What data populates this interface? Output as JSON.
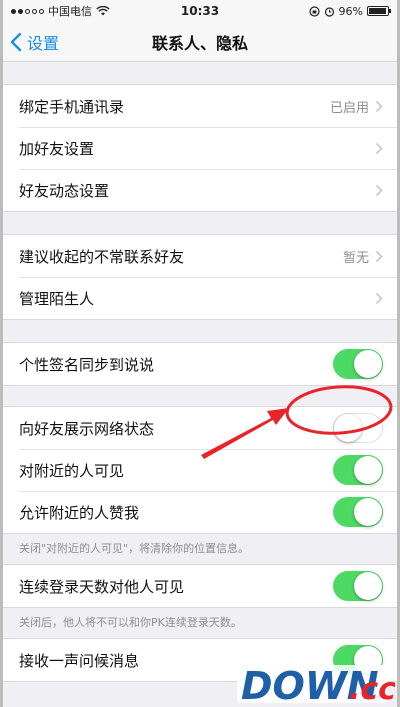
{
  "status_bar": {
    "carrier": "中国电信",
    "time": "10:33",
    "battery": "96%"
  },
  "nav": {
    "back_label": "设置",
    "title": "联系人、隐私"
  },
  "groups": [
    {
      "rows": [
        {
          "label": "绑定手机通讯录",
          "value": "已启用"
        },
        {
          "label": "加好友设置"
        },
        {
          "label": "好友动态设置"
        }
      ]
    },
    {
      "rows": [
        {
          "label": "建议收起的不常联系好友",
          "value": "暂无"
        },
        {
          "label": "管理陌生人"
        }
      ]
    },
    {
      "rows": [
        {
          "label": "个性签名同步到说说",
          "toggle": "on"
        }
      ]
    },
    {
      "rows": [
        {
          "label": "向好友展示网络状态",
          "toggle": "off"
        },
        {
          "label": "对附近的人可见",
          "toggle": "on"
        },
        {
          "label": "允许附近的人赞我",
          "toggle": "on"
        }
      ],
      "note": "关闭\"对附近的人可见\"，将清除你的位置信息。"
    },
    {
      "rows": [
        {
          "label": "连续登录天数对他人可见",
          "toggle": "on"
        }
      ],
      "note": "关闭后，他人将不可以和你PK连续登录天数。"
    },
    {
      "rows": [
        {
          "label": "接收一声问候消息",
          "toggle": "on"
        }
      ]
    }
  ],
  "watermark": {
    "text": "DOWN",
    "suffix": ".cc"
  },
  "colors": {
    "accent": "#1a8fe0",
    "toggle_on": "#4cd964",
    "annotation": "#e8242a",
    "watermark_blue": "#1f5fa8"
  }
}
